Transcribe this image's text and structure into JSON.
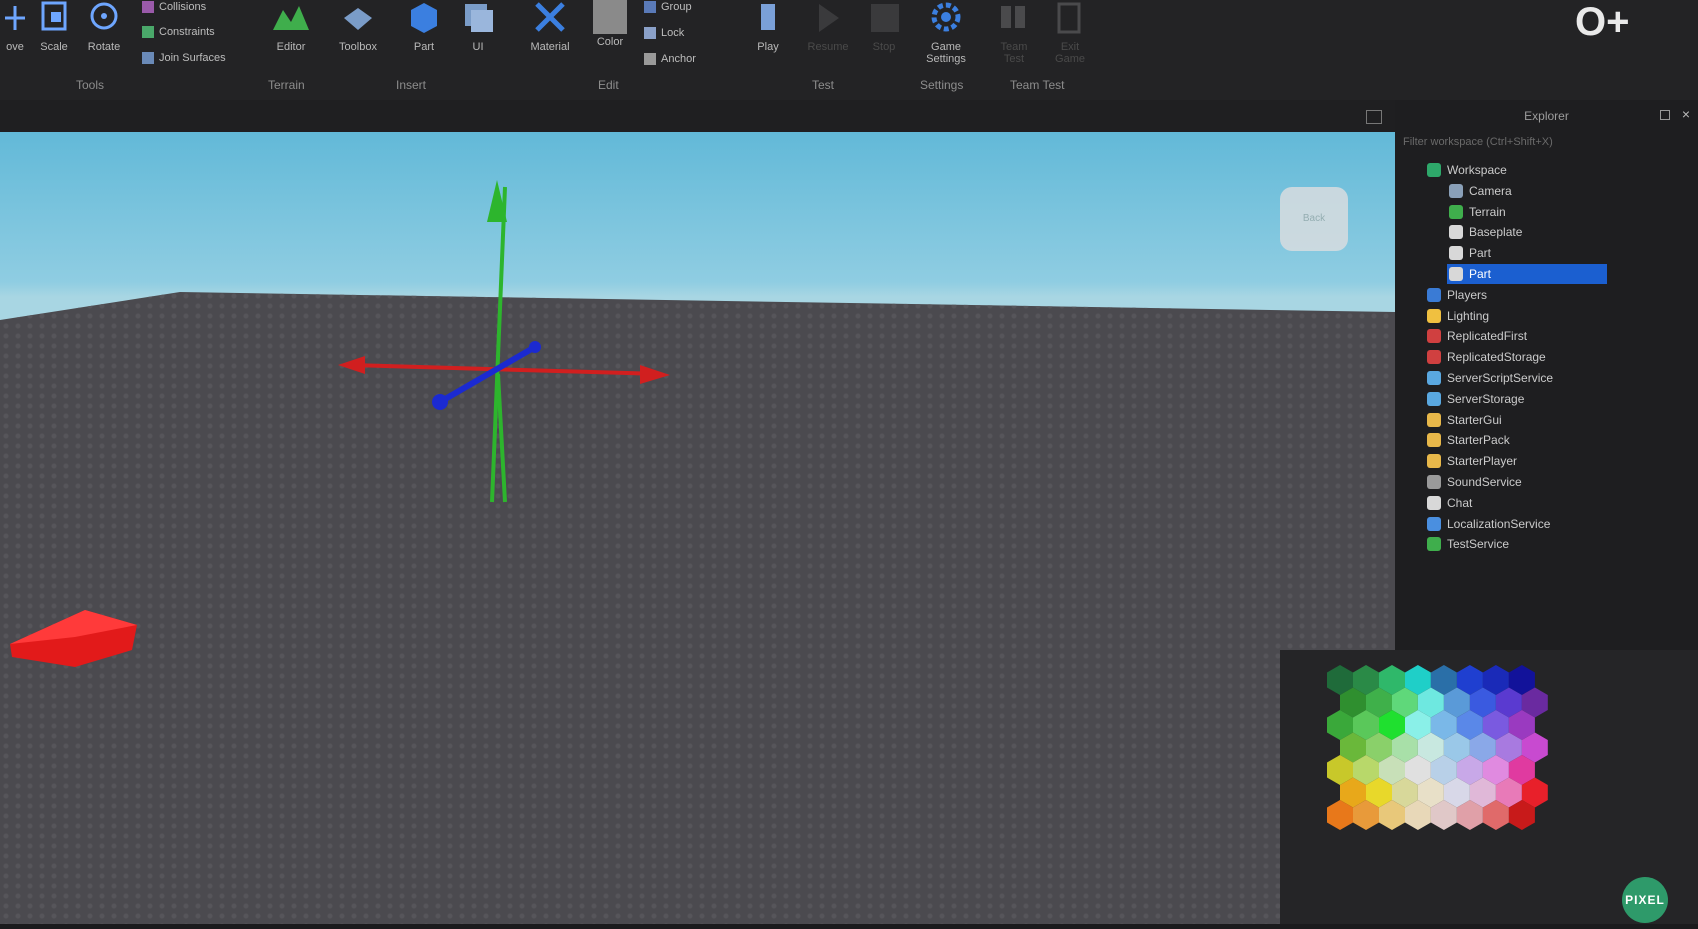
{
  "ribbon": {
    "tools": [
      {
        "label": "ove",
        "icon": "move-icon"
      },
      {
        "label": "Scale",
        "icon": "scale-icon"
      },
      {
        "label": "Rotate",
        "icon": "rotate-icon"
      }
    ],
    "small_tools": [
      "Collisions",
      "Constraints",
      "Join Surfaces"
    ],
    "terrain": {
      "label": "Editor"
    },
    "toolbox": {
      "label": "Toolbox"
    },
    "part": {
      "label": "Part"
    },
    "ui": {
      "label": "UI"
    },
    "material": {
      "label": "Material"
    },
    "color": {
      "label": "Color"
    },
    "edit_items": [
      "Group",
      "Lock",
      "Anchor"
    ],
    "play": {
      "label": "Play"
    },
    "resume": {
      "label": "Resume"
    },
    "stop": {
      "label": "Stop"
    },
    "game_settings": {
      "label": "Game Settings"
    },
    "team_start": {
      "label": "Team Test"
    },
    "exit_game": {
      "label": "Exit Game"
    },
    "groups": [
      "Tools",
      "Terrain",
      "Insert",
      "Edit",
      "Test",
      "Settings",
      "Team Test"
    ]
  },
  "explorer": {
    "title": "Explorer",
    "filter_placeholder": "Filter workspace (Ctrl+Shift+X)",
    "items": [
      {
        "label": "Workspace",
        "level": 0,
        "color": "#2ea86a"
      },
      {
        "label": "Camera",
        "level": 1,
        "color": "#8aa0b8"
      },
      {
        "label": "Terrain",
        "level": 1,
        "color": "#3fae4c"
      },
      {
        "label": "Baseplate",
        "level": 1,
        "color": "#d8d8d8"
      },
      {
        "label": "Part",
        "level": 1,
        "color": "#d8d8d8"
      },
      {
        "label": "Part",
        "level": 1,
        "color": "#d8d8d8",
        "selected": true
      },
      {
        "label": "Players",
        "level": 0,
        "color": "#3a7bd5"
      },
      {
        "label": "Lighting",
        "level": 0,
        "color": "#f0c040"
      },
      {
        "label": "ReplicatedFirst",
        "level": 0,
        "color": "#d04040"
      },
      {
        "label": "ReplicatedStorage",
        "level": 0,
        "color": "#d04040"
      },
      {
        "label": "ServerScriptService",
        "level": 0,
        "color": "#5aa8e0"
      },
      {
        "label": "ServerStorage",
        "level": 0,
        "color": "#5aa8e0"
      },
      {
        "label": "StarterGui",
        "level": 0,
        "color": "#e8b84a"
      },
      {
        "label": "StarterPack",
        "level": 0,
        "color": "#e8b84a"
      },
      {
        "label": "StarterPlayer",
        "level": 0,
        "color": "#e8b84a"
      },
      {
        "label": "SoundService",
        "level": 0,
        "color": "#9a9a9a"
      },
      {
        "label": "Chat",
        "level": 0,
        "color": "#d8d8d8"
      },
      {
        "label": "LocalizationService",
        "level": 0,
        "color": "#4a8fe0"
      },
      {
        "label": "TestService",
        "level": 0,
        "color": "#3fae4c"
      }
    ]
  },
  "viewport": {
    "view_cube_label": "Back"
  },
  "watermark": "PIXEL",
  "top_logo": "O+"
}
